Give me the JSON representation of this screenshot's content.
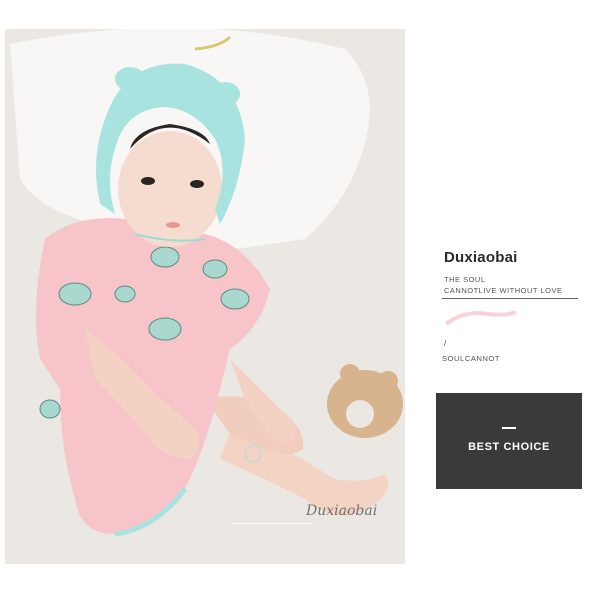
{
  "brand": {
    "name": "Duxiaobai"
  },
  "taglines": {
    "line1": "THE SOUL",
    "line2": "CANNOTLIVE WITHOUT LOVE",
    "slash": "/",
    "line3": "SOULCANNOT"
  },
  "cta": {
    "label": "BEST CHOICE"
  },
  "photo": {
    "subject": "baby in pink bear-print romper and mint bonnet",
    "colors": {
      "romper": "#f6c4c9",
      "bonnet": "#a9e3df",
      "background": "#ebe8e4",
      "toy": "#d8b48e"
    }
  },
  "watermark": {
    "text": "Duxiaobai"
  }
}
